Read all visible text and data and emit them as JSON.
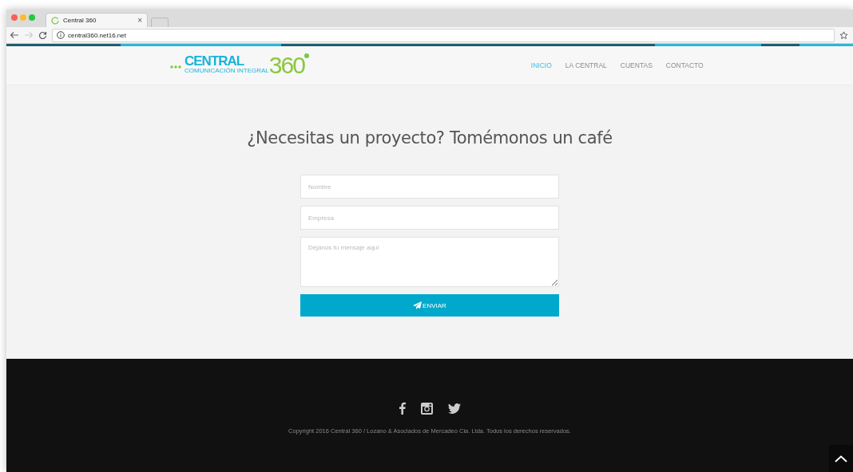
{
  "browser": {
    "tab_title": "Central 360",
    "tab_close": "×",
    "url": "central360.net16.net"
  },
  "logo": {
    "brand": "CENTRAL",
    "number": "360",
    "tagline": "COMUNICACIÓN INTEGRAL"
  },
  "nav": [
    {
      "label": "INICIO",
      "selected": true
    },
    {
      "label": "LA CENTRAL",
      "selected": false
    },
    {
      "label": "CUENTAS",
      "selected": false
    },
    {
      "label": "CONTACTO",
      "selected": false
    }
  ],
  "heading": "¿Necesitas un proyecto? Tomémonos un café",
  "form": {
    "fields": [
      {
        "kind": "input",
        "placeholder": "Nombre"
      },
      {
        "kind": "input",
        "placeholder": "Empresa"
      },
      {
        "kind": "textarea",
        "placeholder": "Déjanos tu mensaje aquí"
      }
    ],
    "submit": "ENVIAR"
  },
  "footer": {
    "copyright": "Copyright 2016 Central 360 / Lozano & Asociados de Mercadeo Cia. Ltda. Todos los derechos reservados."
  }
}
